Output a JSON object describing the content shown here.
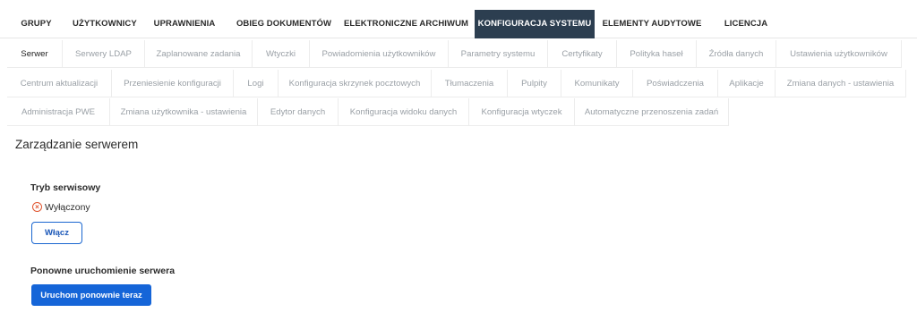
{
  "top_nav": {
    "tabs": [
      {
        "label": "GRUPY"
      },
      {
        "label": "UŻYTKOWNICY"
      },
      {
        "label": "UPRAWNIENIA"
      },
      {
        "label": "OBIEG DOKUMENTÓW"
      },
      {
        "label": "ELEKTRONICZNE ARCHIWUM"
      },
      {
        "label": "KONFIGURACJA SYSTEMU"
      },
      {
        "label": "ELEMENTY AUDYTOWE"
      },
      {
        "label": "LICENCJA"
      }
    ],
    "active": "KONFIGURACJA SYSTEMU"
  },
  "sub_tabs": {
    "row1": [
      "Serwer",
      "Serwery LDAP",
      "Zaplanowane zadania",
      "Wtyczki",
      "Powiadomienia użytkowników",
      "Parametry systemu",
      "Certyfikaty",
      "Polityka haseł",
      "Źródła danych",
      "Ustawienia użytkowników"
    ],
    "row2": [
      "Centrum aktualizacji",
      "Przeniesienie konfiguracji",
      "Logi",
      "Konfiguracja skrzynek pocztowych",
      "Tłumaczenia",
      "Pulpity",
      "Komunikaty",
      "Poświadczenia",
      "Aplikacje",
      "Zmiana danych - ustawienia"
    ],
    "row3": [
      "Administracja PWE",
      "Zmiana użytkownika - ustawienia",
      "Edytor danych",
      "Konfiguracja widoku danych",
      "Konfiguracja wtyczek",
      "Automatyczne przenoszenia zadań"
    ],
    "active": "Serwer"
  },
  "page": {
    "title": "Zarządzanie serwerem",
    "service_mode": {
      "label": "Tryb serwisowy",
      "status_icon": "x-circle-icon",
      "status_text": "Wyłączony",
      "status_color": "#e0552f",
      "enable_button": "Włącz"
    },
    "restart": {
      "label": "Ponowne uruchomienie serwera",
      "button": "Uruchom ponownie teraz"
    }
  },
  "colors": {
    "active_tab_bg": "#2c3e50",
    "primary": "#1565d8"
  }
}
